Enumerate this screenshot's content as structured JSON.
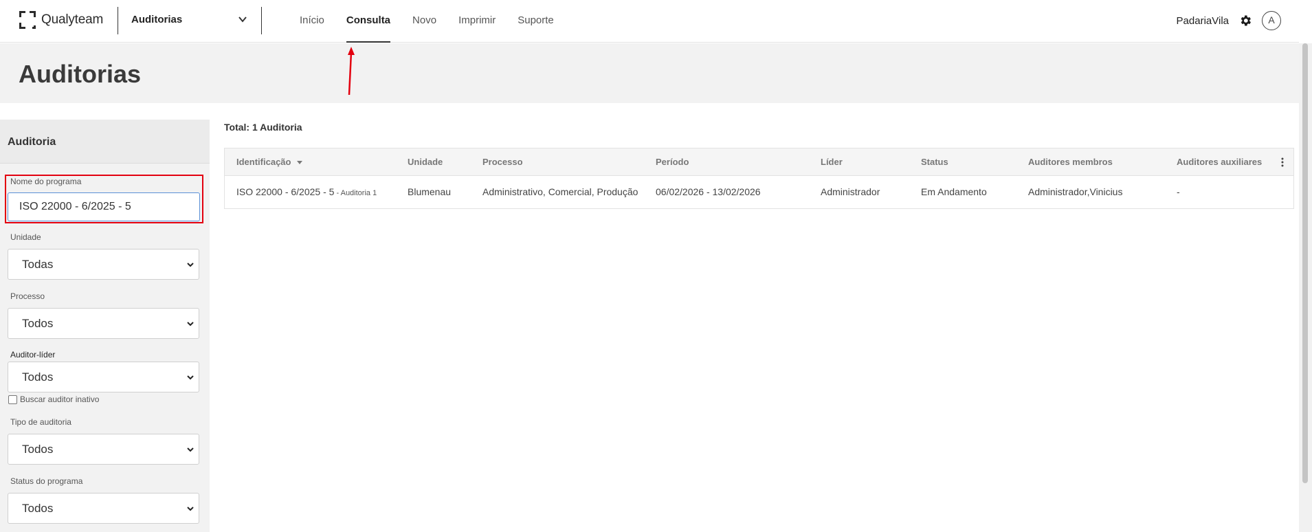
{
  "app": {
    "brand": "Qualyteam",
    "module": "Auditorias"
  },
  "nav": {
    "items": [
      {
        "label": "Início",
        "active": false
      },
      {
        "label": "Consulta",
        "active": true
      },
      {
        "label": "Novo",
        "active": false
      },
      {
        "label": "Imprimir",
        "active": false
      },
      {
        "label": "Suporte",
        "active": false
      }
    ]
  },
  "user": {
    "company": "PadariaVila",
    "avatar_letter": "A"
  },
  "page": {
    "title": "Auditorias"
  },
  "filters": {
    "header": "Auditoria",
    "program_name": {
      "label": "Nome do programa",
      "value": "ISO 22000 - 6/2025 - 5"
    },
    "unit": {
      "label": "Unidade",
      "value": "Todas"
    },
    "process": {
      "label": "Processo",
      "value": "Todos"
    },
    "lead_auditor": {
      "label": "Auditor-líder",
      "value": "Todos"
    },
    "inactive_checkbox": {
      "label": "Buscar auditor inativo",
      "checked": false
    },
    "audit_type": {
      "label": "Tipo de auditoria",
      "value": "Todos"
    },
    "program_status": {
      "label": "Status do programa",
      "value": "Todos"
    }
  },
  "results": {
    "total": "Total: 1 Auditoria",
    "columns": [
      "Identificação",
      "Unidade",
      "Processo",
      "Período",
      "Líder",
      "Status",
      "Auditores membros",
      "Auditores auxiliares"
    ],
    "rows": [
      {
        "identification": "ISO 22000 - 6/2025 - 5",
        "identification_suffix": " - Auditoria 1",
        "unit": "Blumenau",
        "process": "Administrativo, Comercial, Produção",
        "period": "06/02/2026 - 13/02/2026",
        "leader": "Administrador",
        "status": "Em Andamento",
        "members": "Administrador,Vinicius",
        "auxiliaries": "-"
      }
    ]
  },
  "colors": {
    "highlight": "#e3000f",
    "input_focus": "#5a8fd6",
    "header_bg": "#f2f2f2"
  }
}
